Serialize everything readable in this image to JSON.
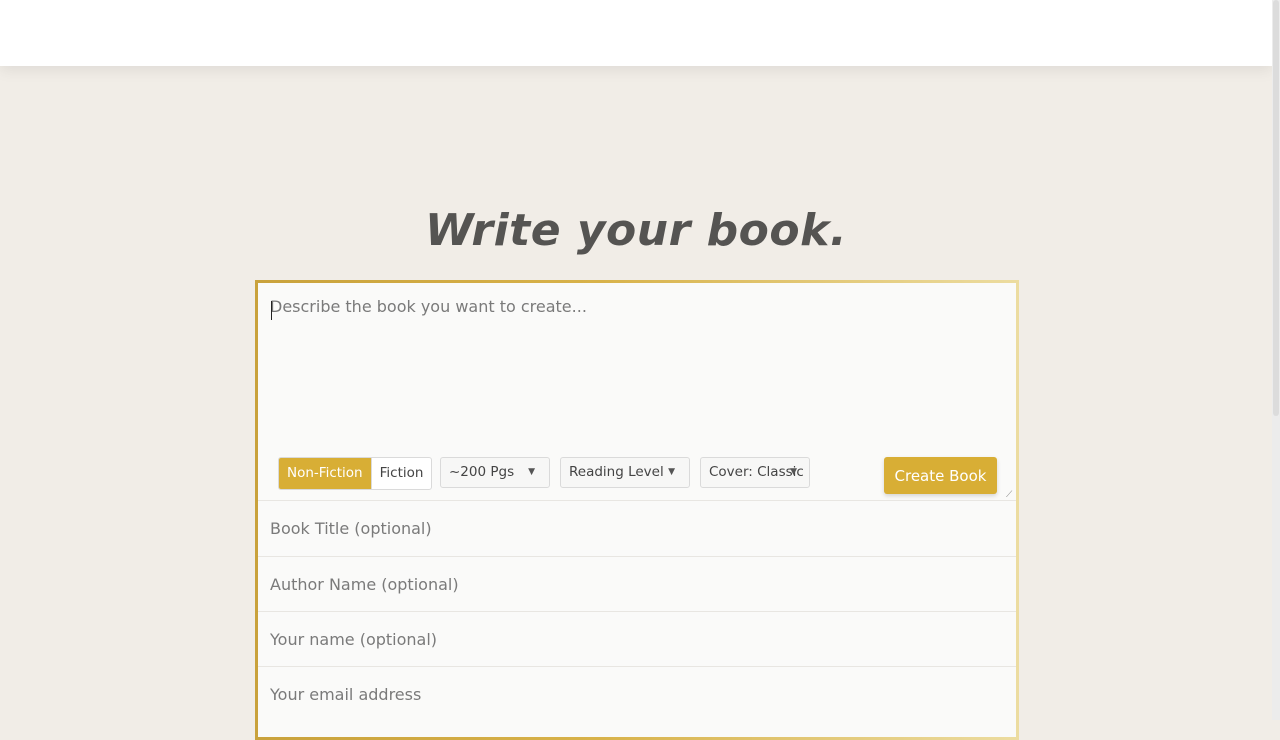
{
  "page": {
    "heading": "Write your book."
  },
  "form": {
    "description_placeholder": "Describe the book you want to create...",
    "genre_options": [
      "Non-Fiction",
      "Fiction"
    ],
    "genre_selected": "Non-Fiction",
    "length_select": "~200 Pgs",
    "reading_level_select": "Reading Level",
    "cover_select": "Cover: Classic",
    "create_button": "Create Book",
    "title_placeholder": "Book Title (optional)",
    "author_placeholder": "Author Name (optional)",
    "your_name_placeholder": "Your name (optional)",
    "email_placeholder": "Your email address"
  },
  "colors": {
    "accent": "#d8ae35",
    "background": "#f1ede7",
    "heading": "#555452"
  },
  "icons": {
    "dropdown": "caret-down-icon",
    "resize": "resize-handle-icon"
  }
}
